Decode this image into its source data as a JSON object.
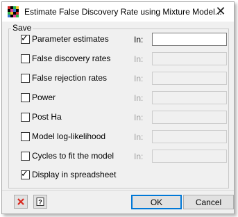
{
  "window": {
    "title": "Estimate False Discovery Rate using Mixture Model...",
    "close_glyph": "✕"
  },
  "save_group": {
    "label": "Save",
    "in_label": "In:",
    "options": [
      {
        "label": "Parameter estimates",
        "checked": true,
        "field_enabled": true,
        "value": ""
      },
      {
        "label": "False discovery rates",
        "checked": false,
        "field_enabled": false,
        "value": ""
      },
      {
        "label": "False rejection rates",
        "checked": false,
        "field_enabled": false,
        "value": ""
      },
      {
        "label": "Power",
        "checked": false,
        "field_enabled": false,
        "value": ""
      },
      {
        "label": "Post Ha",
        "checked": false,
        "field_enabled": false,
        "value": ""
      },
      {
        "label": "Model log-likelihood",
        "checked": false,
        "field_enabled": false,
        "value": ""
      },
      {
        "label": "Cycles to fit the model",
        "checked": false,
        "field_enabled": false,
        "value": ""
      }
    ],
    "display_spreadsheet": {
      "label": "Display in spreadsheet",
      "checked": true
    }
  },
  "buttons": {
    "ok": "OK",
    "cancel": "Cancel",
    "clear_icon": "clear-icon",
    "help_icon": "help-icon"
  },
  "colors": {
    "clear_red": "#d9261c",
    "focus_blue": "#0078d7"
  }
}
